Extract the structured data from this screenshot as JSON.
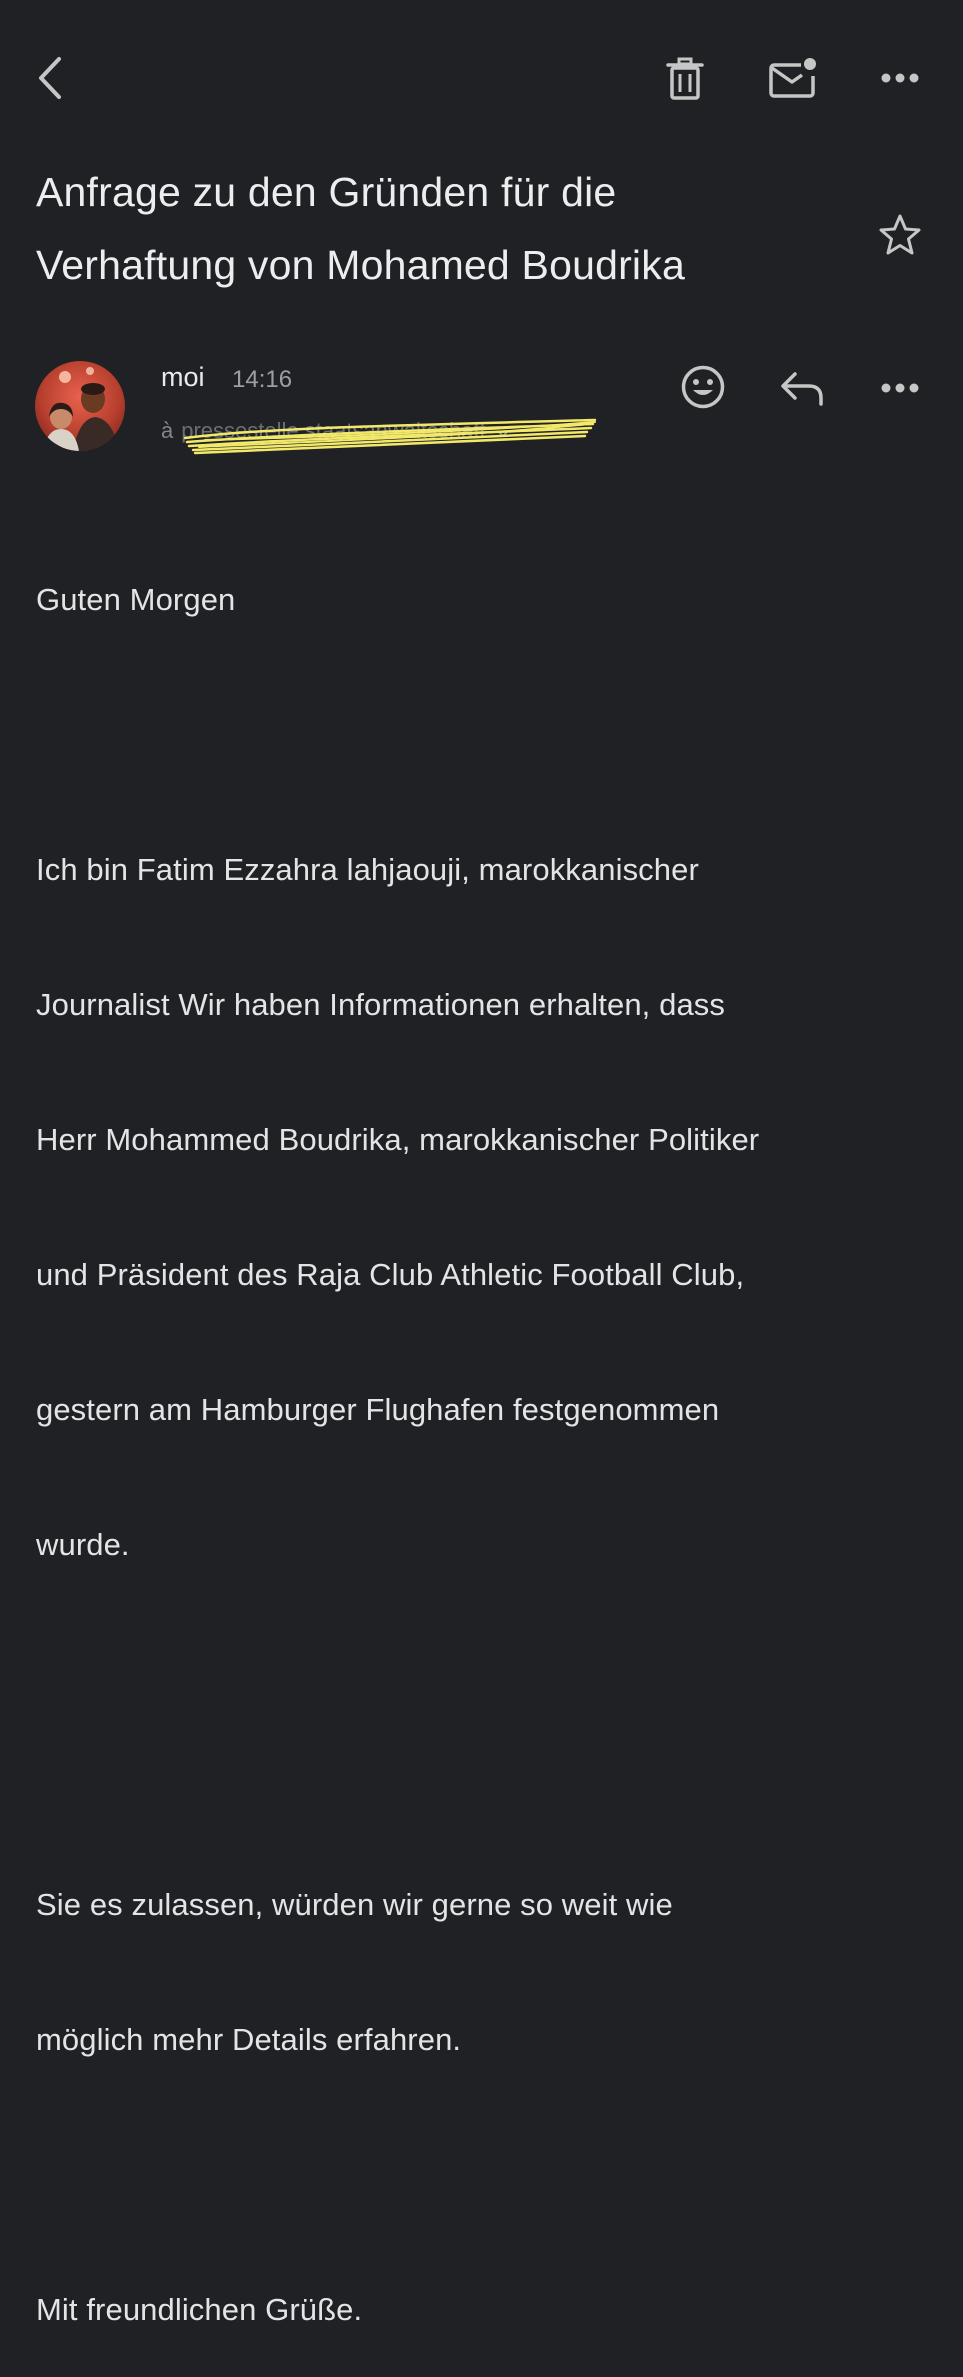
{
  "toolbar": {
    "back_icon": "chevron-left-icon",
    "delete_icon": "trash-icon",
    "mark_unread_icon": "mail-unread-icon",
    "more_icon": "more-horizontal-icon"
  },
  "email": {
    "subject_lines": [
      "Anfrage zu den Gründen für die",
      "Verhaftung von Mohamed Boudrika"
    ],
    "star_icon": "star-outline-icon",
    "sender": {
      "name": "moi",
      "time": "14:16",
      "recipient_prefix": "à",
      "recipient_redacted": "pressestelle staatsanwaltschaft"
    },
    "message_actions": {
      "emoji_icon": "emoji-reaction-icon",
      "reply_icon": "reply-icon",
      "more_icon": "more-horizontal-icon"
    },
    "body": {
      "greeting": "Guten Morgen",
      "paragraph1_lines": [
        " Ich bin Fatim Ezzahra lahjaouji, marokkanischer",
        "Journalist Wir haben Informationen erhalten, dass",
        "Herr Mohammed Boudrika, marokkanischer Politiker",
        "und Präsident des Raja Club Athletic Football Club,",
        "gestern am Hamburger Flughafen festgenommen",
        "wurde."
      ],
      "paragraph2_lines": [
        " Sie es zulassen, würden wir gerne so weit wie",
        "möglich mehr Details erfahren."
      ],
      "closing": " Mit freundlichen Grüße."
    }
  },
  "colors": {
    "background": "#202124",
    "text_primary": "#e8eaed",
    "text_secondary": "#9aa0a6",
    "highlight_scribble": "#f2e96b"
  }
}
